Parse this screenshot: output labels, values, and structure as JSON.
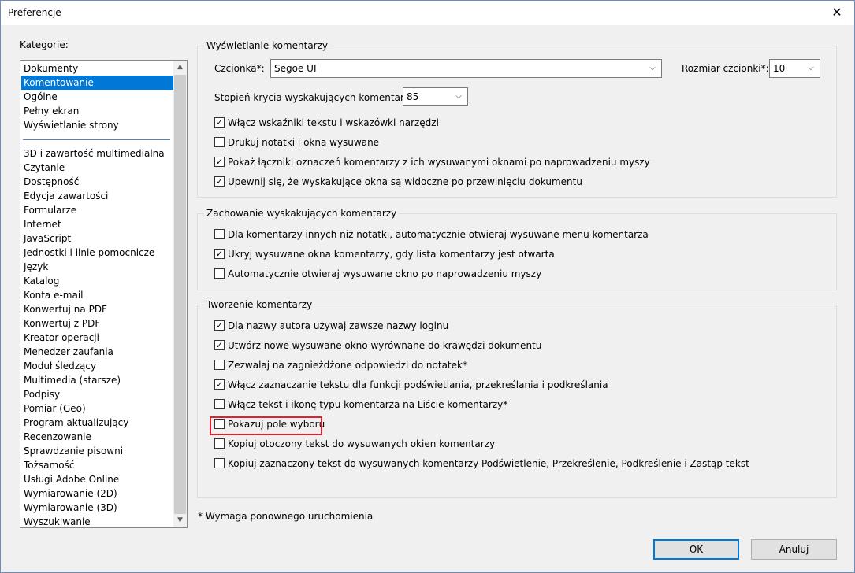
{
  "window": {
    "title": "Preferencje",
    "close_glyph": "✕"
  },
  "categories": {
    "label": "Kategorie:",
    "top_items": [
      {
        "label": "Dokumenty",
        "selected": false
      },
      {
        "label": "Komentowanie",
        "selected": true
      },
      {
        "label": "Ogólne",
        "selected": false
      },
      {
        "label": "Pełny ekran",
        "selected": false
      },
      {
        "label": "Wyświetlanie strony",
        "selected": false
      }
    ],
    "items": [
      "3D i zawartość multimedialna",
      "Czytanie",
      "Dostępność",
      "Edycja zawartości",
      "Formularze",
      "Internet",
      "JavaScript",
      "Jednostki i linie pomocnicze",
      "Język",
      "Katalog",
      "Konta e-mail",
      "Konwertuj na PDF",
      "Konwertuj z PDF",
      "Kreator operacji",
      "Menedżer zaufania",
      "Moduł śledzący",
      "Multimedia (starsze)",
      "Podpisy",
      "Pomiar (Geo)",
      "Program aktualizujący",
      "Recenzowanie",
      "Sprawdzanie pisowni",
      "Tożsamość",
      "Usługi Adobe Online",
      "Wymiarowanie (2D)",
      "Wymiarowanie (3D)",
      "Wyszukiwanie"
    ],
    "scroll_up_glyph": "▲",
    "scroll_down_glyph": "▼"
  },
  "display": {
    "title": "Wyświetlanie komentarzy",
    "font_label": "Czcionka*:",
    "font_value": "Segoe UI",
    "font_size_label": "Rozmiar czcionki*:",
    "font_size_value": "10",
    "opacity_label": "Stopień krycia wyskakujących komentarzy:",
    "opacity_value": "85",
    "checkboxes": [
      {
        "label": "Włącz wskaźniki tekstu i wskazówki narzędzi",
        "checked": true
      },
      {
        "label": "Drukuj notatki i okna wysuwane",
        "checked": false
      },
      {
        "label": "Pokaż łączniki oznaczeń komentarzy z ich wysuwanymi oknami po naprowadzeniu myszy",
        "checked": true
      },
      {
        "label": "Upewnij się, że wyskakujące okna są widoczne po przewinięciu dokumentu",
        "checked": true
      }
    ]
  },
  "popup": {
    "title": "Zachowanie wyskakujących komentarzy",
    "checkboxes": [
      {
        "label": "Dla komentarzy innych niż notatki, automatycznie otwieraj wysuwane menu komentarza",
        "checked": false
      },
      {
        "label": "Ukryj wysuwane okna komentarzy, gdy lista komentarzy jest otwarta",
        "checked": true
      },
      {
        "label": "Automatycznie otwieraj wysuwane okno po naprowadzeniu myszy",
        "checked": false
      }
    ]
  },
  "creation": {
    "title": "Tworzenie komentarzy",
    "checkboxes": [
      {
        "label": "Dla nazwy autora używaj zawsze nazwy loginu",
        "checked": true
      },
      {
        "label": "Utwórz nowe wysuwane okno wyrównane do krawędzi dokumentu",
        "checked": true
      },
      {
        "label": "Zezwalaj na zagnieżdżone odpowiedzi do notatek*",
        "checked": false
      },
      {
        "label": "Włącz zaznaczanie tekstu dla funkcji podświetlania, przekreślania i podkreślania",
        "checked": true
      },
      {
        "label": "Włącz tekst i ikonę typu komentarza na Liście komentarzy*",
        "checked": false
      },
      {
        "label": "Pokazuj pole wyboru",
        "checked": false
      },
      {
        "label": "Kopiuj otoczony tekst do wysuwanych okien komentarzy",
        "checked": false
      },
      {
        "label": "Kopiuj zaznaczony tekst do wysuwanych komentarzy Podświetlenie, Przekreślenie, Podkreślenie i Zastąp tekst",
        "checked": false
      }
    ]
  },
  "footnote": "* Wymaga ponownego uruchomienia",
  "buttons": {
    "ok": "OK",
    "cancel": "Anuluj"
  },
  "colors": {
    "selection": "#0078d7",
    "highlight_border": "#e0202a",
    "default_button_border": "#0078d7"
  },
  "glyphs": {
    "check": "✓",
    "dropdown": "⌵"
  }
}
